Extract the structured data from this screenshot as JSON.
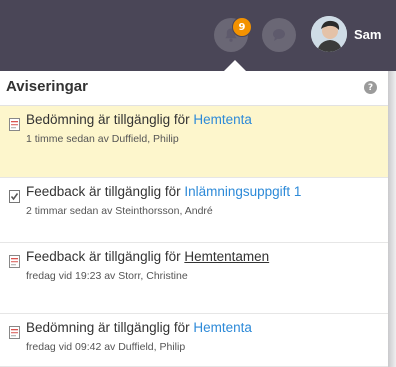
{
  "colors": {
    "topbar": "#4a4657",
    "badge": "#f39200",
    "highlight": "#fdf6cc",
    "link": "#2d8ad8"
  },
  "header": {
    "notification_count": "9",
    "user_name": "Sam",
    "bell_icon": "bell-icon",
    "chat_icon": "chat-bubble-icon"
  },
  "panel": {
    "title": "Aviseringar",
    "help_icon_glyph": "?"
  },
  "notifications": [
    {
      "prefix": "Bedömning är tillgänglig för ",
      "link": "Hemtenta",
      "meta": "1 timme sedan av Duffield, Philip",
      "icon": "document-icon",
      "highlighted": true,
      "underlined": false
    },
    {
      "prefix": "Feedback är tillgänglig för ",
      "link": "Inlämningsuppgift 1",
      "meta": "2 timmar sedan av Steinthorsson, André",
      "icon": "checked-document-icon",
      "highlighted": false,
      "underlined": false
    },
    {
      "prefix": "Feedback är tillgänglig för ",
      "link": "Hemtentamen",
      "meta": "fredag vid 19:23 av Storr, Christine",
      "icon": "document-icon",
      "highlighted": false,
      "underlined": true
    },
    {
      "prefix": "Bedömning är tillgänglig för ",
      "link": "Hemtenta",
      "meta": "fredag vid 09:42 av Duffield, Philip",
      "icon": "document-icon",
      "highlighted": false,
      "underlined": false
    }
  ]
}
